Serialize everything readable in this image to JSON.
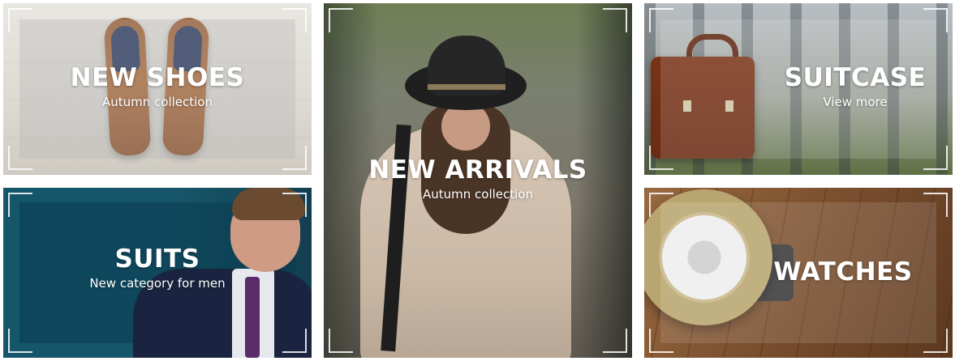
{
  "tiles": [
    {
      "title": "NEW SHOES",
      "subtitle": "Autumn collection"
    },
    {
      "title": "NEW ARRIVALS",
      "subtitle": "Autumn collection"
    },
    {
      "title": "SUITCASE",
      "subtitle": "View more"
    },
    {
      "title": "SUITS",
      "subtitle": "New category for men"
    },
    {
      "title": "WATCHES",
      "subtitle": ""
    }
  ]
}
